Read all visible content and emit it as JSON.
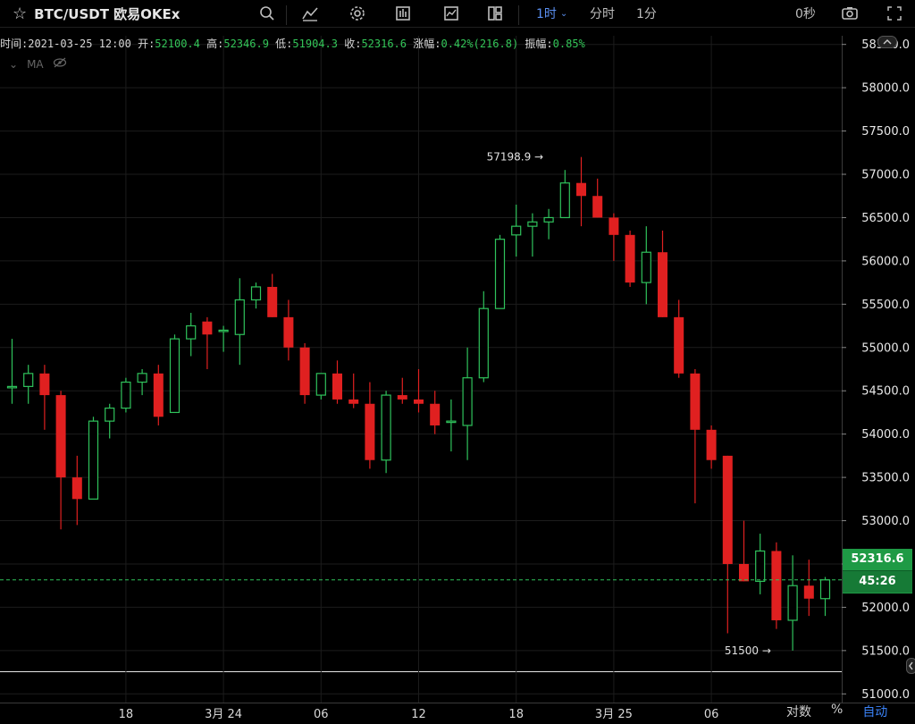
{
  "toolbar": {
    "symbol": "BTC/USDT 欧易OKEx",
    "timeframes": {
      "hour": "1时",
      "minute_time": "分时",
      "one_min": "1分"
    },
    "countdown_label": "0秒"
  },
  "info": {
    "time_label": "时间:",
    "time": "2021-03-25 12:00",
    "open_label": "开:",
    "open": "52100.4",
    "high_label": "高:",
    "high": "52346.9",
    "low_label": "低:",
    "low": "51904.3",
    "close_label": "收:",
    "close": "52316.6",
    "change_label": "涨幅:",
    "change": "0.42%(216.8)",
    "amp_label": "振幅:",
    "amp": "0.85%"
  },
  "ma_label": "MA",
  "current": {
    "price": "52316.6",
    "countdown": "45:26"
  },
  "bottom": {
    "log": "对数",
    "pct": "%",
    "auto": "自动"
  },
  "chart_data": {
    "type": "candlestick",
    "ylim": [
      50900,
      58600
    ],
    "yticks": [
      51000,
      51500,
      52000,
      52500,
      53000,
      53500,
      54000,
      54500,
      55000,
      55500,
      56000,
      56500,
      57000,
      57500,
      58000,
      58500
    ],
    "xticks": [
      {
        "index": 7,
        "label": "18"
      },
      {
        "index": 13,
        "label": "3月 24"
      },
      {
        "index": 19,
        "label": "06"
      },
      {
        "index": 25,
        "label": "12"
      },
      {
        "index": 31,
        "label": "18"
      },
      {
        "index": 37,
        "label": "3月 25"
      },
      {
        "index": 43,
        "label": "06"
      }
    ],
    "annotations": [
      {
        "index": 33,
        "value": 57198.9,
        "text": "57198.9 →"
      },
      {
        "index": 47,
        "value": 51500,
        "text": "51500 →"
      }
    ],
    "current_price": 52316.6,
    "colors": {
      "up": "#2fc25b",
      "down": "#e02020",
      "dash": "#2fc25b"
    },
    "candles": [
      {
        "o": 54550,
        "h": 55100,
        "l": 54350,
        "c": 54550
      },
      {
        "o": 54550,
        "h": 54800,
        "l": 54350,
        "c": 54700
      },
      {
        "o": 54700,
        "h": 54800,
        "l": 54050,
        "c": 54450
      },
      {
        "o": 54450,
        "h": 54500,
        "l": 52900,
        "c": 53500
      },
      {
        "o": 53500,
        "h": 53750,
        "l": 52950,
        "c": 53250
      },
      {
        "o": 53250,
        "h": 54200,
        "l": 53250,
        "c": 54150
      },
      {
        "o": 54150,
        "h": 54350,
        "l": 53950,
        "c": 54300
      },
      {
        "o": 54300,
        "h": 54650,
        "l": 54250,
        "c": 54600
      },
      {
        "o": 54600,
        "h": 54750,
        "l": 54450,
        "c": 54700
      },
      {
        "o": 54700,
        "h": 54800,
        "l": 54100,
        "c": 54200
      },
      {
        "o": 54250,
        "h": 55150,
        "l": 54250,
        "c": 55100
      },
      {
        "o": 55100,
        "h": 55400,
        "l": 54900,
        "c": 55250
      },
      {
        "o": 55300,
        "h": 55350,
        "l": 54750,
        "c": 55150
      },
      {
        "o": 55200,
        "h": 55250,
        "l": 54950,
        "c": 55200
      },
      {
        "o": 55150,
        "h": 55800,
        "l": 54800,
        "c": 55550
      },
      {
        "o": 55550,
        "h": 55750,
        "l": 55450,
        "c": 55700
      },
      {
        "o": 55700,
        "h": 55850,
        "l": 55350,
        "c": 55350
      },
      {
        "o": 55350,
        "h": 55550,
        "l": 54850,
        "c": 55000
      },
      {
        "o": 55000,
        "h": 55050,
        "l": 54350,
        "c": 54450
      },
      {
        "o": 54450,
        "h": 54700,
        "l": 54400,
        "c": 54700
      },
      {
        "o": 54700,
        "h": 54850,
        "l": 54350,
        "c": 54400
      },
      {
        "o": 54400,
        "h": 54700,
        "l": 54300,
        "c": 54350
      },
      {
        "o": 54350,
        "h": 54600,
        "l": 53600,
        "c": 53700
      },
      {
        "o": 53700,
        "h": 54500,
        "l": 53550,
        "c": 54450
      },
      {
        "o": 54450,
        "h": 54650,
        "l": 54350,
        "c": 54400
      },
      {
        "o": 54400,
        "h": 54750,
        "l": 54250,
        "c": 54350
      },
      {
        "o": 54350,
        "h": 54500,
        "l": 54000,
        "c": 54100
      },
      {
        "o": 54150,
        "h": 54400,
        "l": 53800,
        "c": 54150
      },
      {
        "o": 54100,
        "h": 55000,
        "l": 53700,
        "c": 54650
      },
      {
        "o": 54650,
        "h": 55650,
        "l": 54600,
        "c": 55450
      },
      {
        "o": 55450,
        "h": 56300,
        "l": 55450,
        "c": 56250
      },
      {
        "o": 56300,
        "h": 56650,
        "l": 56050,
        "c": 56400
      },
      {
        "o": 56400,
        "h": 56550,
        "l": 56050,
        "c": 56450
      },
      {
        "o": 56450,
        "h": 56600,
        "l": 56250,
        "c": 56500
      },
      {
        "o": 56500,
        "h": 57050,
        "l": 56500,
        "c": 56900
      },
      {
        "o": 56900,
        "h": 57200,
        "l": 56400,
        "c": 56750
      },
      {
        "o": 56750,
        "h": 56950,
        "l": 56500,
        "c": 56500
      },
      {
        "o": 56500,
        "h": 56550,
        "l": 56000,
        "c": 56300
      },
      {
        "o": 56300,
        "h": 56350,
        "l": 55700,
        "c": 55750
      },
      {
        "o": 55750,
        "h": 56400,
        "l": 55500,
        "c": 56100
      },
      {
        "o": 56100,
        "h": 56350,
        "l": 55350,
        "c": 55350
      },
      {
        "o": 55350,
        "h": 55550,
        "l": 54650,
        "c": 54700
      },
      {
        "o": 54700,
        "h": 54750,
        "l": 53200,
        "c": 54050
      },
      {
        "o": 54050,
        "h": 54100,
        "l": 53600,
        "c": 53700
      },
      {
        "o": 53750,
        "h": 53750,
        "l": 51700,
        "c": 52500
      },
      {
        "o": 52500,
        "h": 53000,
        "l": 52300,
        "c": 52300
      },
      {
        "o": 52300,
        "h": 52850,
        "l": 52150,
        "c": 52650
      },
      {
        "o": 52650,
        "h": 52750,
        "l": 51750,
        "c": 51850
      },
      {
        "o": 51850,
        "h": 52600,
        "l": 51500,
        "c": 52250
      },
      {
        "o": 52250,
        "h": 52550,
        "l": 51900,
        "c": 52100
      },
      {
        "o": 52100,
        "h": 52350,
        "l": 51900,
        "c": 52316.6
      }
    ]
  }
}
